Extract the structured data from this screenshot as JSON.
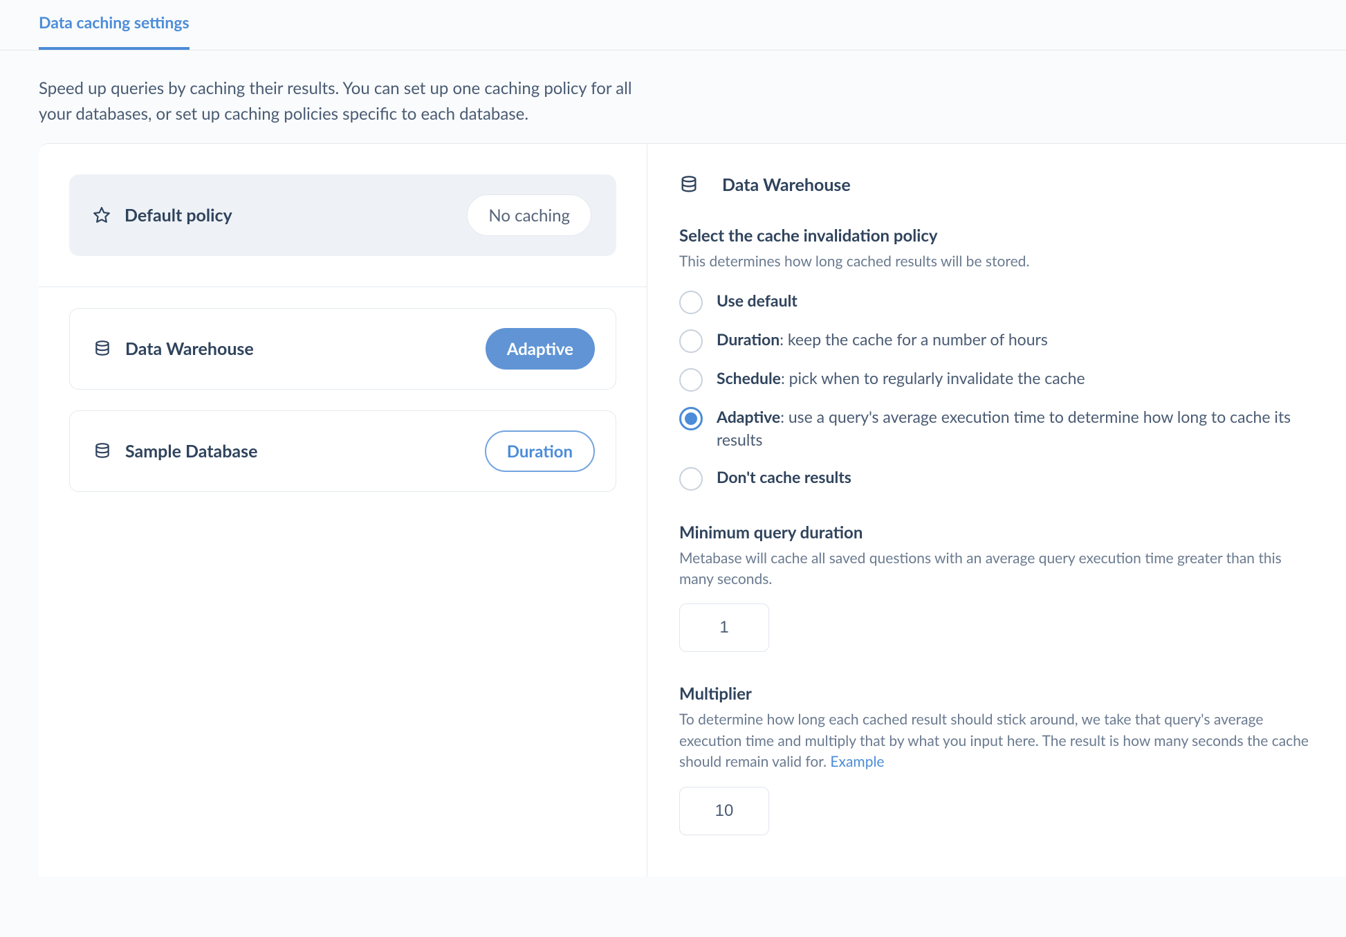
{
  "tab": {
    "label": "Data caching settings"
  },
  "intro": "Speed up queries by caching their results. You can set up one caching policy for all your databases, or set up caching policies specific to each database.",
  "policy_list": {
    "default": {
      "label": "Default policy",
      "badge": "No caching"
    },
    "databases": [
      {
        "name": "Data Warehouse",
        "badge": "Adaptive",
        "badge_style": "solid-blue"
      },
      {
        "name": "Sample Database",
        "badge": "Duration",
        "badge_style": "outline-blue"
      }
    ]
  },
  "detail": {
    "title": "Data Warehouse",
    "invalidation": {
      "heading": "Select the cache invalidation policy",
      "sub": "This determines how long cached results will be stored.",
      "options": [
        {
          "bold": "Use default",
          "rest": "",
          "checked": false
        },
        {
          "bold": "Duration",
          "rest": ": keep the cache for a number of hours",
          "checked": false
        },
        {
          "bold": "Schedule",
          "rest": ": pick when to regularly invalidate the cache",
          "checked": false
        },
        {
          "bold": "Adaptive",
          "rest": ": use a query's average execution time to determine how long to cache its results",
          "checked": true
        },
        {
          "bold": "Don't cache results",
          "rest": "",
          "checked": false
        }
      ]
    },
    "min_duration": {
      "heading": "Minimum query duration",
      "sub": "Metabase will cache all saved questions with an average query execution time greater than this many seconds.",
      "value": "1"
    },
    "multiplier": {
      "heading": "Multiplier",
      "sub_pre": "To determine how long each cached result should stick around, we take that query's average execution time and multiply that by what you input here. The result is how many seconds the cache should remain valid for. ",
      "link": "Example",
      "value": "10"
    }
  }
}
